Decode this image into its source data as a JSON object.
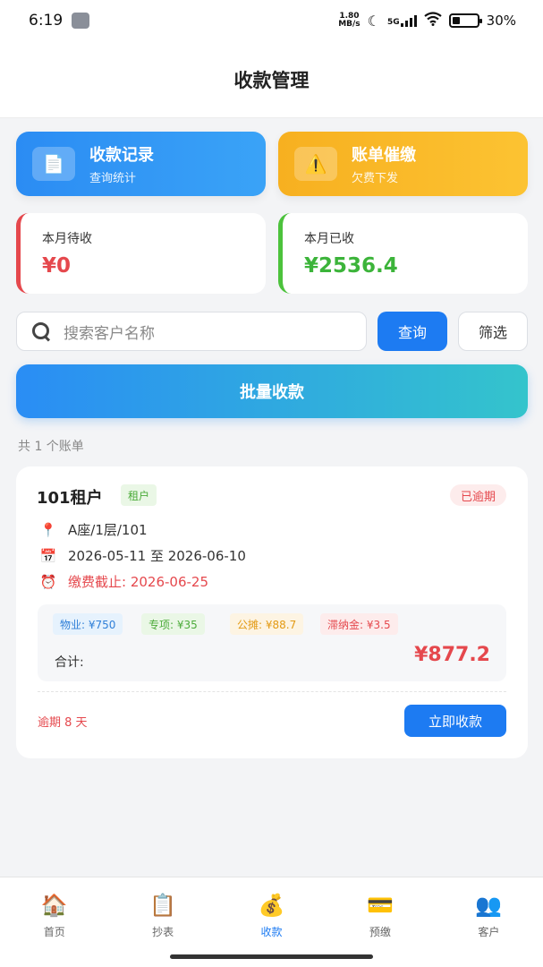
{
  "status_bar": {
    "time": "6:19",
    "net_speed_top": "1.80",
    "net_speed_bottom": "MB/s",
    "network": "5G",
    "battery": "30%",
    "battery_level": 0.3
  },
  "header": {
    "title": "收款管理"
  },
  "actions": [
    {
      "title": "收款记录",
      "subtitle": "查询统计",
      "icon": "📄"
    },
    {
      "title": "账单催缴",
      "subtitle": "欠费下发",
      "icon": "⚠️"
    }
  ],
  "stats": {
    "pending_label": "本月待收",
    "pending_value": "¥0",
    "received_label": "本月已收",
    "received_value": "¥2536.4"
  },
  "search": {
    "placeholder": "搜索客户名称",
    "query_label": "查询",
    "filter_label": "筛选"
  },
  "batch_label": "批量收款",
  "bill_count": "共 1 个账单",
  "bill": {
    "name": "101租户",
    "type_tag": "租户",
    "status": "已逾期",
    "location_icon": "📍",
    "location": "A座/1层/101",
    "period_icon": "📅",
    "period": "2026-05-11 至 2026-06-10",
    "deadline_icon": "⏰",
    "deadline": "缴费截止: 2026-06-25",
    "fees": [
      "物业: ¥750",
      "专项: ¥35",
      "公摊: ¥88.7",
      "滞纳金: ¥3.5"
    ],
    "total_label": "合计:",
    "total_value": "¥877.2",
    "overdue_days": "逾期 8 天",
    "pay_label": "立即收款"
  },
  "tabs": [
    {
      "label": "首页",
      "icon": "🏠"
    },
    {
      "label": "抄表",
      "icon": "📋"
    },
    {
      "label": "收款",
      "icon": "💰"
    },
    {
      "label": "预缴",
      "icon": "💳"
    },
    {
      "label": "客户",
      "icon": "👥"
    }
  ],
  "colors": {
    "primary": "#1d7bf2",
    "danger": "#e5484d",
    "success": "#3cb43a",
    "warning": "#f7b020"
  }
}
